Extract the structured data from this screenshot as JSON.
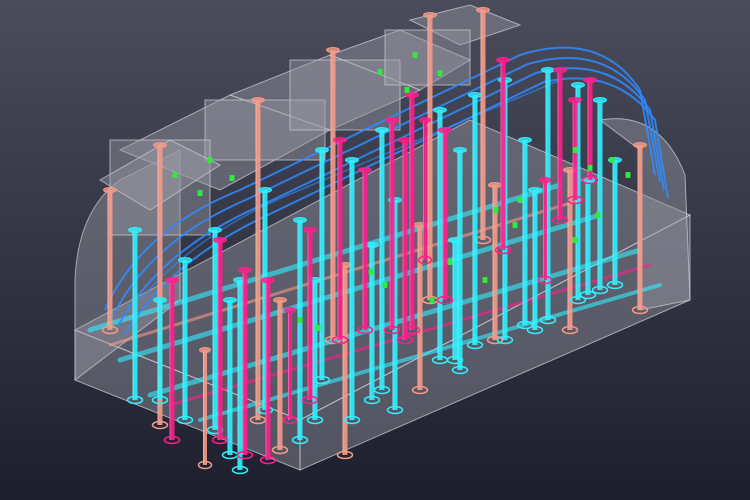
{
  "viewport": {
    "background_top": "#4a4c5c",
    "background_bottom": "#1d1f2e",
    "structure_fill": "#9a9aa6",
    "structure_edge": "#c8c8d0"
  },
  "palette": {
    "cyan_pipe": "#2ef0ff",
    "magenta_pipe": "#ff1e8c",
    "salmon_pipe": "#f59a86",
    "blue_arch": "#2f8cff",
    "marker_green": "#31e83c"
  },
  "components": {
    "pipe_groups": [
      "cyan_pipe",
      "magenta_pipe",
      "salmon_pipe"
    ],
    "arch_color": "blue_arch",
    "marker_color": "marker_green"
  }
}
